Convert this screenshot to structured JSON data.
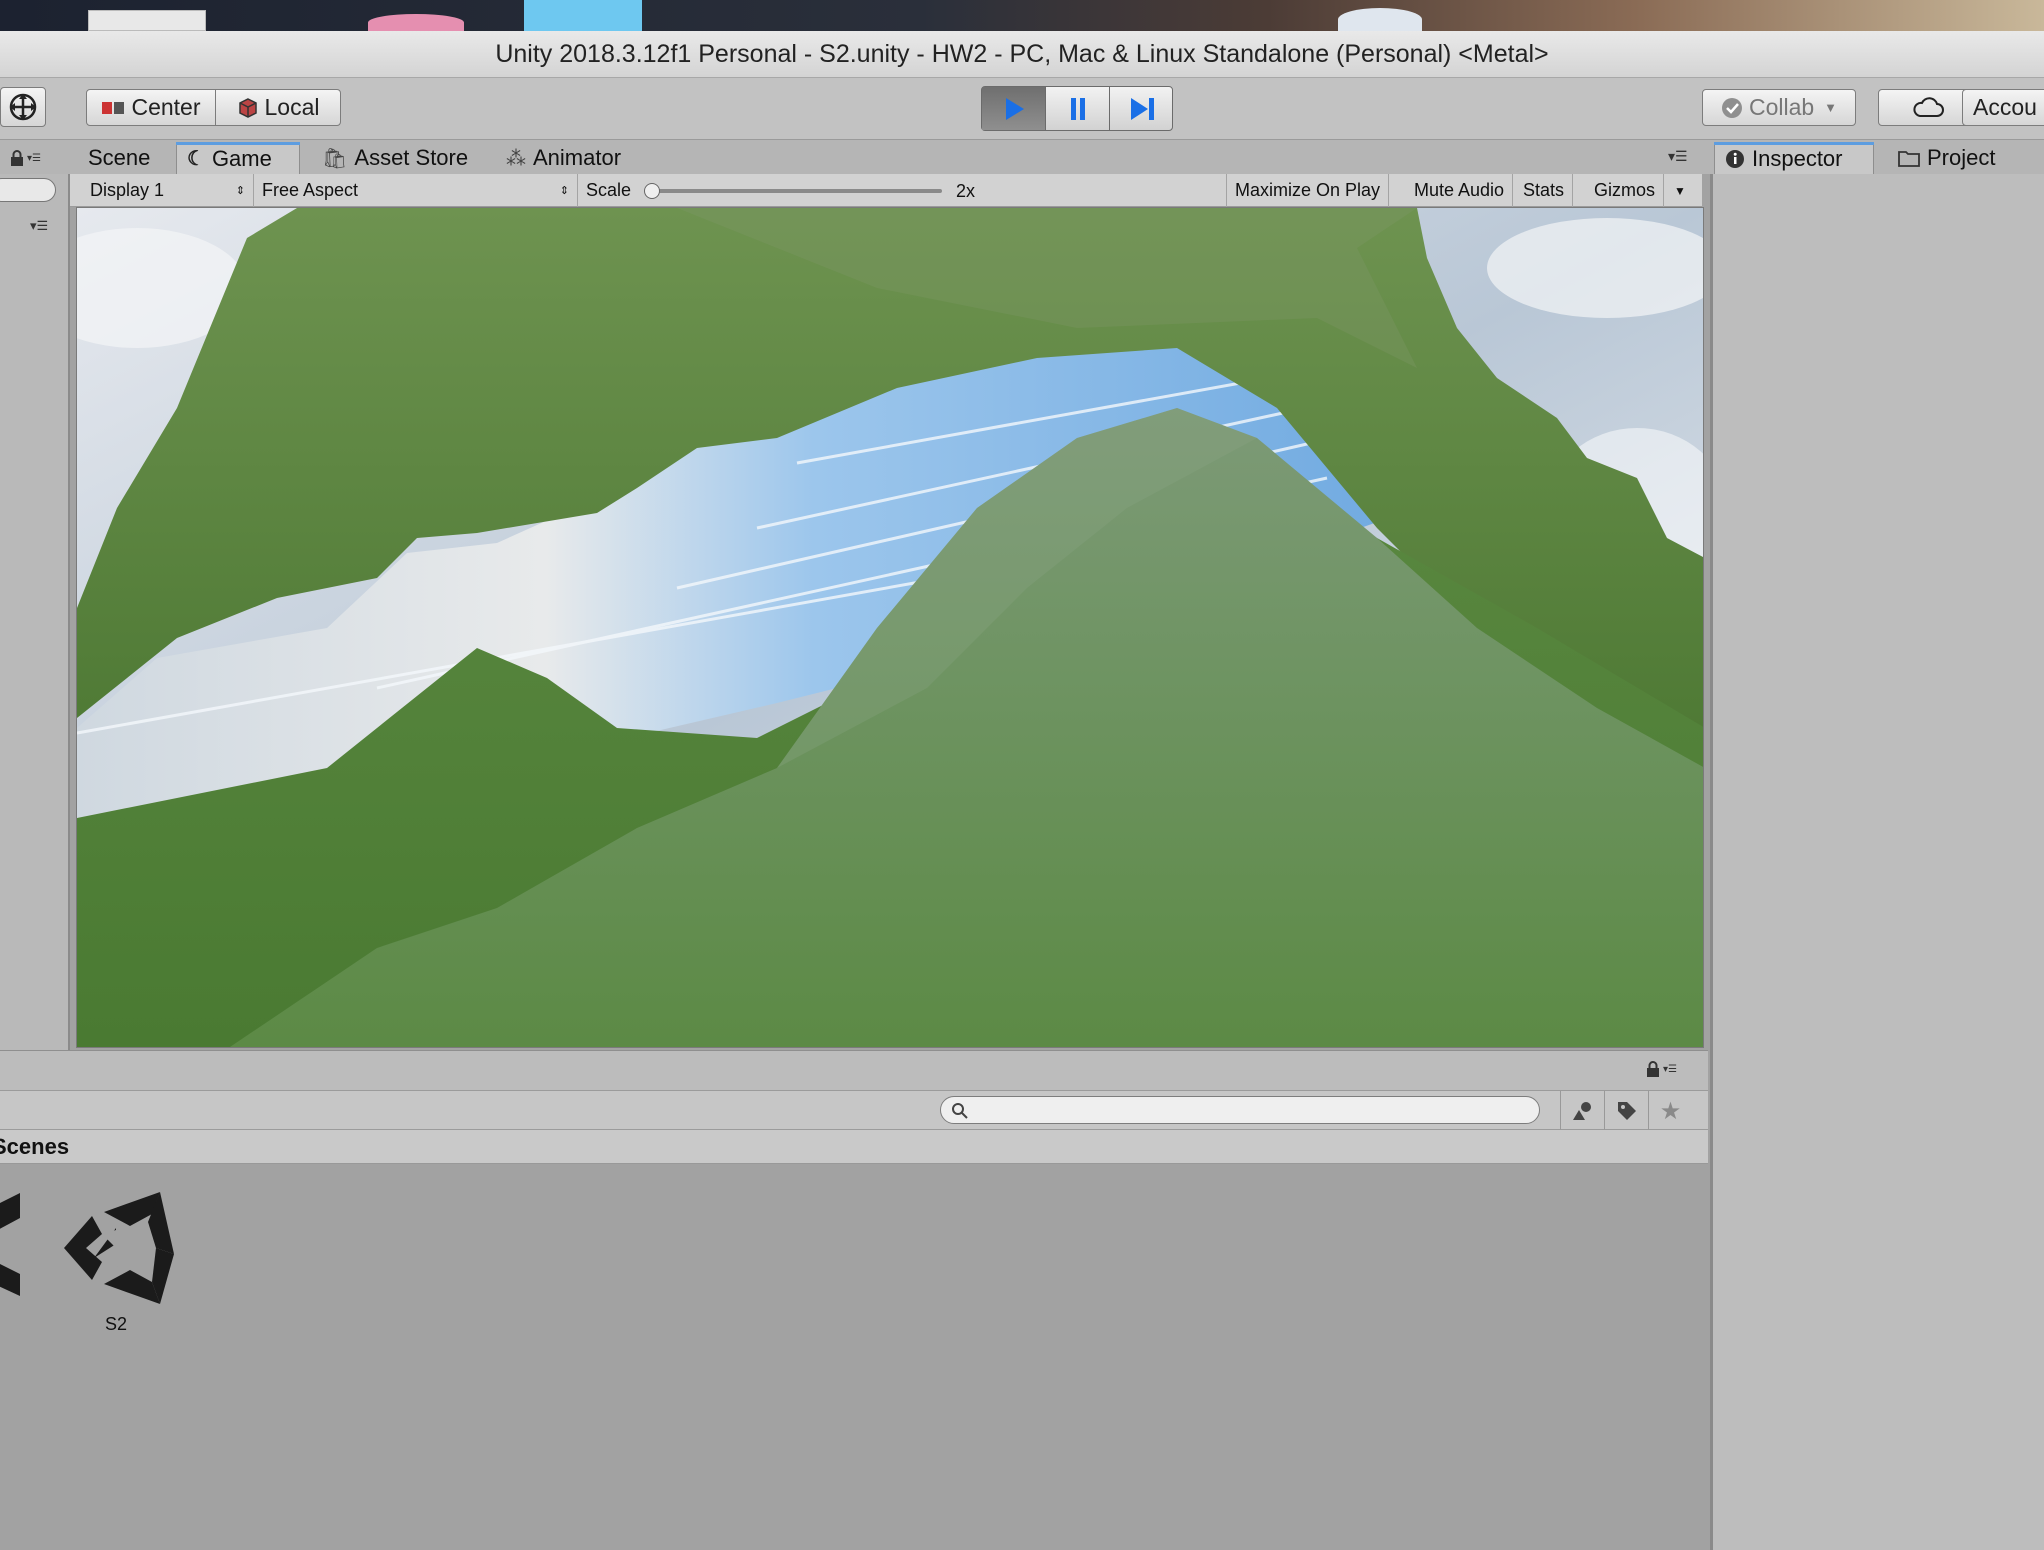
{
  "window": {
    "title": "Unity 2018.3.12f1 Personal - S2.unity - HW2 - PC, Mac & Linux Standalone (Personal) <Metal>"
  },
  "toolbar": {
    "center_label": "Center",
    "local_label": "Local",
    "collab_label": "Collab",
    "account_label": "Accou"
  },
  "tabs": {
    "scene": "Scene",
    "game": "Game",
    "asset_store": "Asset Store",
    "animator": "Animator",
    "inspector": "Inspector",
    "project": "Project"
  },
  "game_toolbar": {
    "display": "Display 1",
    "aspect": "Free Aspect",
    "scale_label": "Scale",
    "scale_value": "2x",
    "maximize": "Maximize On Play",
    "mute": "Mute Audio",
    "stats": "Stats",
    "gizmos": "Gizmos"
  },
  "project": {
    "breadcrumb": "Scenes",
    "search_value": "",
    "assets": [
      {
        "name": "S2",
        "icon": "unity-scene-icon"
      }
    ]
  },
  "colors": {
    "play_accent": "#1a6fe6",
    "tab_accent": "#5d9de0",
    "grass": "#5f8a45",
    "water": "#8fbde6",
    "sky": "#d9dde2"
  }
}
